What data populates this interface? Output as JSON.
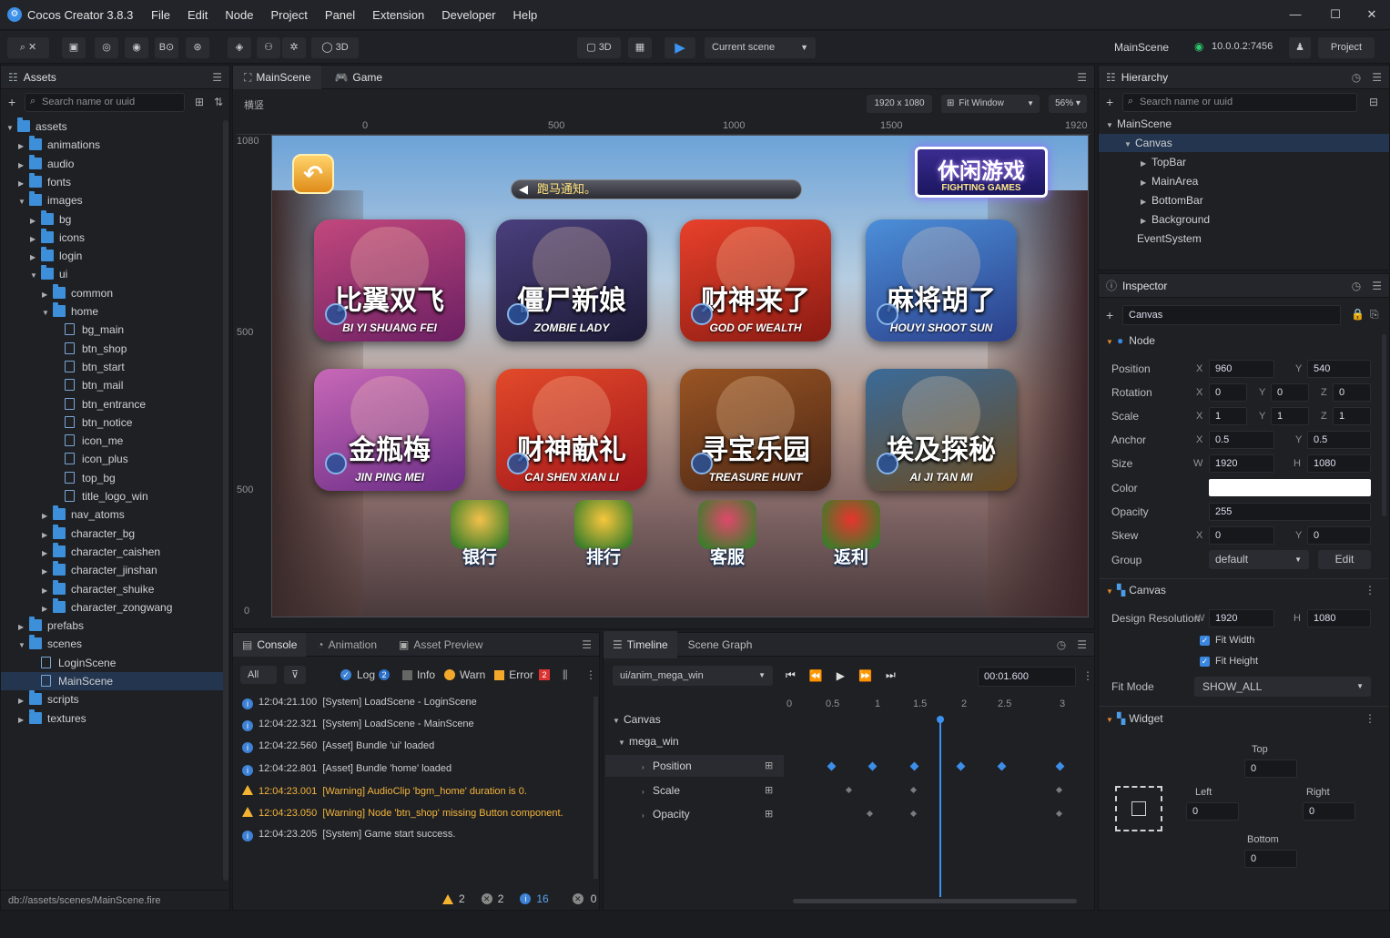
{
  "app": {
    "title": "Cocos Creator 3.8.3",
    "menu": [
      "File",
      "Edit",
      "Node",
      "Project",
      "Panel",
      "Extension",
      "Developer",
      "Help"
    ],
    "window_controls": [
      "—",
      "☐",
      "✕"
    ]
  },
  "toolbar": {
    "mode_3d": "3D",
    "view_3d": "3D",
    "scene_select": "Current scene",
    "scene_name": "MainScene",
    "ip": "10.0.0.2:7456",
    "project_button": "Project"
  },
  "assets": {
    "title": "Assets",
    "search_placeholder": "Search name or uuid",
    "status_path": "db://assets/scenes/MainScene.fire",
    "items": [
      {
        "label": "assets",
        "type": "folder",
        "depth": 0,
        "open": true
      },
      {
        "label": "animations",
        "type": "folder",
        "depth": 1
      },
      {
        "label": "audio",
        "type": "folder",
        "depth": 1
      },
      {
        "label": "fonts",
        "type": "folder",
        "depth": 1
      },
      {
        "label": "images",
        "type": "folder",
        "depth": 1,
        "open": true
      },
      {
        "label": "bg",
        "type": "folder",
        "depth": 2
      },
      {
        "label": "icons",
        "type": "folder",
        "depth": 2
      },
      {
        "label": "login",
        "type": "folder",
        "depth": 2
      },
      {
        "label": "ui",
        "type": "folder",
        "depth": 2,
        "open": true
      },
      {
        "label": "common",
        "type": "folder",
        "depth": 3
      },
      {
        "label": "home",
        "type": "folder",
        "depth": 3,
        "open": true
      },
      {
        "label": "bg_main",
        "type": "file",
        "depth": 4
      },
      {
        "label": "btn_shop",
        "type": "file",
        "depth": 4
      },
      {
        "label": "btn_start",
        "type": "file",
        "depth": 4
      },
      {
        "label": "btn_mail",
        "type": "file",
        "depth": 4
      },
      {
        "label": "btn_entrance",
        "type": "file",
        "depth": 4
      },
      {
        "label": "btn_notice",
        "type": "file",
        "depth": 4
      },
      {
        "label": "icon_me",
        "type": "file",
        "depth": 4
      },
      {
        "label": "icon_plus",
        "type": "file",
        "depth": 4
      },
      {
        "label": "top_bg",
        "type": "file",
        "depth": 4
      },
      {
        "label": "title_logo_win",
        "type": "file",
        "depth": 4
      },
      {
        "label": "nav_atoms",
        "type": "folder",
        "depth": 3
      },
      {
        "label": "character_bg",
        "type": "folder",
        "depth": 3
      },
      {
        "label": "character_caishen",
        "type": "folder",
        "depth": 3
      },
      {
        "label": "character_jinshan",
        "type": "folder",
        "depth": 3
      },
      {
        "label": "character_shuike",
        "type": "folder",
        "depth": 3
      },
      {
        "label": "character_zongwang",
        "type": "folder",
        "depth": 3
      },
      {
        "label": "prefabs",
        "type": "folder",
        "depth": 1
      },
      {
        "label": "scenes",
        "type": "folder",
        "depth": 1,
        "open": true
      },
      {
        "label": "LoginScene",
        "type": "file",
        "depth": 2
      },
      {
        "label": "MainScene",
        "type": "file",
        "depth": 2,
        "selected": true
      },
      {
        "label": "scripts",
        "type": "folder",
        "depth": 1
      },
      {
        "label": "textures",
        "type": "folder",
        "depth": 1
      }
    ]
  },
  "scene": {
    "tabs": [
      "MainScene",
      "Game"
    ],
    "resolution": "1920 x 1080",
    "fit": "Fit Window",
    "zoom": "56%",
    "top_label": "横竖",
    "ruler_x": [
      "0",
      "500",
      "1000",
      "1500",
      "1920"
    ],
    "ruler_y": [
      "1080",
      "500",
      "500",
      "0"
    ],
    "game": {
      "notice": "跑马通知。",
      "logo_main": "休闲游戏",
      "logo_sub": "FIGHTING GAMES",
      "cards": [
        {
          "cn": "比翼双飞",
          "en": "BI YI SHUANG FEI",
          "c1": "#c2487d",
          "c2": "#6b1f63"
        },
        {
          "cn": "僵尸新娘",
          "en": "ZOMBIE LADY",
          "c1": "#4a3f7d",
          "c2": "#1c1a36"
        },
        {
          "cn": "财神来了",
          "en": "GOD OF WEALTH",
          "c1": "#e8412b",
          "c2": "#8a1a12"
        },
        {
          "cn": "麻将胡了",
          "en": "HOUYI SHOOT SUN",
          "c1": "#4c8fd9",
          "c2": "#2b3f8a"
        },
        {
          "cn": "金瓶梅",
          "en": "JIN PING MEI",
          "c1": "#c868b7",
          "c2": "#6a2d86"
        },
        {
          "cn": "财神献礼",
          "en": "CAI SHEN XIAN LI",
          "c1": "#e24a2a",
          "c2": "#a3161a"
        },
        {
          "cn": "寻宝乐园",
          "en": "TREASURE HUNT",
          "c1": "#9a5524",
          "c2": "#4a2614"
        },
        {
          "cn": "埃及探秘",
          "en": "AI JI TAN MI",
          "c1": "#3a6b9a",
          "c2": "#6a4a1f"
        }
      ],
      "bottom": [
        "银行",
        "排行",
        "客服",
        "返利"
      ]
    }
  },
  "console": {
    "tabs": [
      "Console",
      "Animation",
      "Asset Preview"
    ],
    "filter": "All",
    "log": "Log",
    "log_count": "2",
    "info": "Info",
    "warn": "Warn",
    "error": "Error",
    "error_count": "2",
    "lines": [
      {
        "time": "12:04:21.100",
        "msg": "[System] LoadScene - LoginScene",
        "level": "info"
      },
      {
        "time": "12:04:22.321",
        "msg": "[System] LoadScene - MainScene",
        "level": "info"
      },
      {
        "time": "12:04:22.560",
        "msg": "[Asset] Bundle 'ui' loaded",
        "level": "info"
      },
      {
        "time": "12:04:22.801",
        "msg": "[Asset] Bundle 'home' loaded",
        "level": "info"
      },
      {
        "time": "12:04:23.001",
        "msg": "[Warning] AudioClip 'bgm_home' duration is 0.",
        "level": "warn"
      },
      {
        "time": "12:04:23.050",
        "msg": "[Warning] Node 'btn_shop' missing Button component.",
        "level": "warn"
      },
      {
        "time": "12:04:23.205",
        "msg": "[System] Game start success.",
        "level": "info"
      }
    ],
    "footer": {
      "warn": "2",
      "error": "2",
      "info": "16",
      "other": "0"
    }
  },
  "timeline": {
    "tabs": [
      "Timeline",
      "Scene Graph"
    ],
    "clip": "ui/anim_mega_win",
    "time": "00:01.600",
    "ticks": [
      "0",
      "0.5",
      "1",
      "1.5",
      "2",
      "2.5",
      "3"
    ],
    "tracks": {
      "root": "Canvas",
      "child": "mega_win",
      "props": [
        "Position",
        "Scale",
        "Opacity"
      ]
    }
  },
  "hierarchy": {
    "title": "Hierarchy",
    "search_placeholder": "Search name or uuid",
    "items": [
      "MainScene",
      "Canvas",
      "TopBar",
      "MainArea",
      "BottomBar",
      "Background",
      "EventSystem"
    ]
  },
  "inspector": {
    "title": "Inspector",
    "node_name": "Canvas",
    "node_section": "Node",
    "position": {
      "label": "Position",
      "x": "960",
      "y": "540"
    },
    "rotation": {
      "label": "Rotation",
      "x": "0",
      "y": "0",
      "z": "0"
    },
    "scale": {
      "label": "Scale",
      "x": "1",
      "y": "1",
      "z": "1"
    },
    "anchor": {
      "label": "Anchor",
      "x": "0.5",
      "y": "0.5"
    },
    "size": {
      "label": "Size",
      "w": "1920",
      "h": "1080"
    },
    "color": {
      "label": "Color",
      "value": "#ffffff"
    },
    "opacity": {
      "label": "Opacity",
      "value": "255"
    },
    "skew": {
      "label": "Skew",
      "x": "0",
      "y": "0"
    },
    "group": {
      "label": "Group",
      "value": "default",
      "edit": "Edit"
    },
    "canvas": {
      "title": "Canvas",
      "design_label": "Design Resolution",
      "w": "1920",
      "h": "1080",
      "fit_width": "Fit Width",
      "fit_height": "Fit Height",
      "fit_mode_label": "Fit Mode",
      "fit_mode": "SHOW_ALL"
    },
    "widget": {
      "title": "Widget",
      "top_label": "Top",
      "top": "0",
      "left_label": "Left",
      "left": "0",
      "right_label": "Right",
      "right": "0",
      "bottom_label": "Bottom",
      "bottom": "0"
    }
  },
  "axis_labels": {
    "x": "X",
    "y": "Y",
    "z": "Z",
    "w": "W",
    "h": "H"
  }
}
